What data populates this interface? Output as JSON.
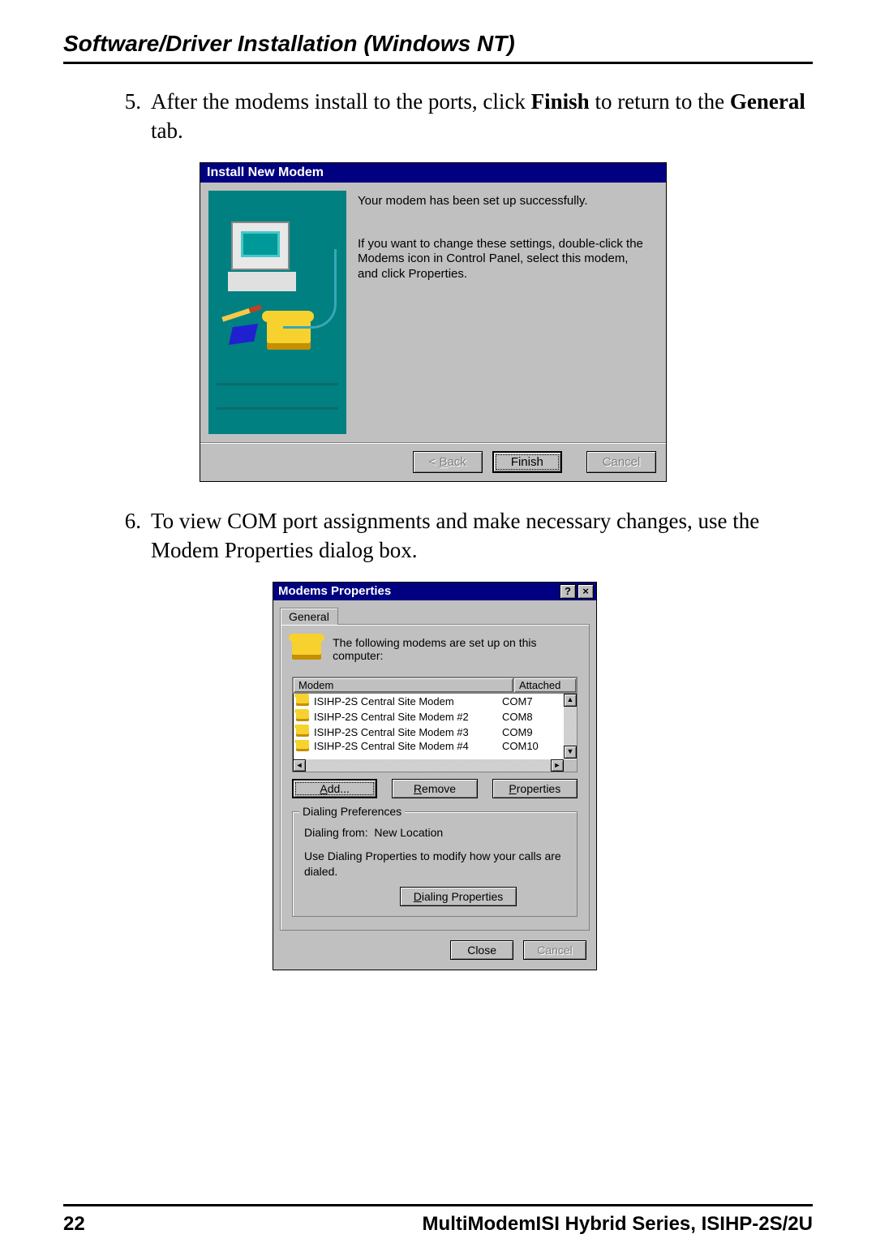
{
  "header": {
    "section_title": "Software/Driver Installation (Windows NT)"
  },
  "steps": {
    "s5": {
      "num": "5.",
      "before": "After the modems install to the ports, click ",
      "b1": "Finish",
      "mid": " to return to the ",
      "b2": "General",
      "after": " tab."
    },
    "s6": {
      "num": "6.",
      "text": "To view COM port assignments and make necessary changes, use the Modem Properties dialog box."
    }
  },
  "dlg1": {
    "title": "Install New Modem",
    "line1": "Your modem has been set up successfully.",
    "line2": "If you want to change these settings, double-click the Modems icon in Control Panel, select this modem, and click Properties.",
    "back": "< Back",
    "finish": "Finish",
    "cancel": "Cancel"
  },
  "dlg2": {
    "title": "Modems Properties",
    "help_btn": "?",
    "close_btn": "×",
    "tab_general": "General",
    "intro": "The following modems are set up on this computer:",
    "col_modem": "Modem",
    "col_attached": "Attached",
    "rows": [
      {
        "name": "ISIHP-2S Central Site Modem",
        "port": "COM7"
      },
      {
        "name": "ISIHP-2S Central Site Modem #2",
        "port": "COM8"
      },
      {
        "name": "ISIHP-2S Central Site Modem #3",
        "port": "COM9"
      },
      {
        "name": "ISIHP-2S Central Site Modem #4",
        "port": "COM10"
      }
    ],
    "add": "Add...",
    "remove": "Remove",
    "properties": "Properties",
    "group_title": "Dialing Preferences",
    "dialing_from_label": "Dialing from:",
    "dialing_from_value": "New Location",
    "dialing_hint": "Use Dialing Properties to modify how your calls are dialed.",
    "dialing_props": "Dialing Properties",
    "close": "Close",
    "cancel": "Cancel"
  },
  "footer": {
    "page": "22",
    "title": "MultiModemISI Hybrid Series, ISIHP-2S/2U"
  }
}
